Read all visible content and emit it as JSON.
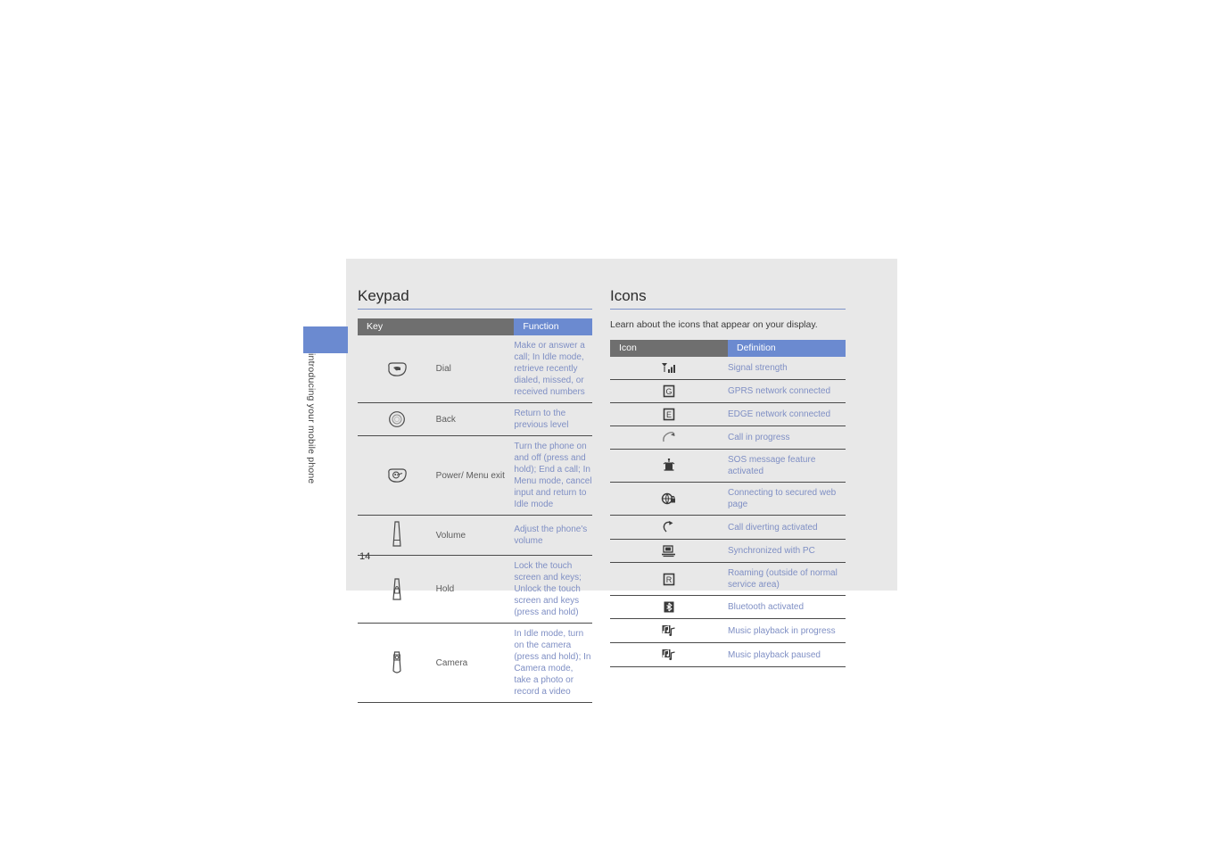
{
  "chapter_tab": {
    "label": "introducing your mobile phone",
    "color": "#6b8ad0"
  },
  "page_number": "14",
  "keypad": {
    "title": "Keypad",
    "columns": {
      "key": "Key",
      "function": "Function"
    },
    "rows": [
      {
        "icon": "dial-key-icon",
        "name": "Dial",
        "function": "Make or answer a call; In Idle mode, retrieve recently dialed, missed, or received numbers"
      },
      {
        "icon": "back-key-icon",
        "name": "Back",
        "function": "Return to the previous level"
      },
      {
        "icon": "power-menu-exit-key-icon",
        "name": "Power/ Menu exit",
        "function": "Turn the phone on and off (press and hold); End a call; In Menu mode, cancel input and return to Idle mode"
      },
      {
        "icon": "volume-key-icon",
        "name": "Volume",
        "function": "Adjust the phone's volume"
      },
      {
        "icon": "hold-key-icon",
        "name": "Hold",
        "function": "Lock the touch screen and keys; Unlock the touch screen and keys (press and hold)"
      },
      {
        "icon": "camera-key-icon",
        "name": "Camera",
        "function": "In Idle mode, turn on the camera (press and hold); In Camera mode, take a photo or record a video"
      }
    ]
  },
  "icons": {
    "title": "Icons",
    "lead": "Learn about the icons that appear on your display.",
    "columns": {
      "icon": "Icon",
      "definition": "Definition"
    },
    "rows": [
      {
        "icon": "signal-strength-icon",
        "definition": "Signal strength"
      },
      {
        "icon": "gprs-network-icon",
        "definition": "GPRS network connected"
      },
      {
        "icon": "edge-network-icon",
        "definition": "EDGE network connected"
      },
      {
        "icon": "call-in-progress-icon",
        "definition": "Call in progress"
      },
      {
        "icon": "sos-message-icon",
        "definition": "SOS message feature activated"
      },
      {
        "icon": "secure-web-icon",
        "definition": "Connecting to secured web page"
      },
      {
        "icon": "call-diverting-icon",
        "definition": "Call diverting activated"
      },
      {
        "icon": "sync-pc-icon",
        "definition": "Synchronized with PC"
      },
      {
        "icon": "roaming-icon",
        "definition": "Roaming (outside of normal service area)"
      },
      {
        "icon": "bluetooth-icon",
        "definition": "Bluetooth activated"
      },
      {
        "icon": "music-playing-icon",
        "definition": "Music playback in progress"
      },
      {
        "icon": "music-paused-icon",
        "definition": "Music playback paused"
      }
    ]
  },
  "colors": {
    "page_background": "#e8e8e8",
    "header_key": "#6f6f6f",
    "header_accent": "#6b8ad0",
    "body_text": "#7f8fc4",
    "rule": "#7d93c9"
  }
}
